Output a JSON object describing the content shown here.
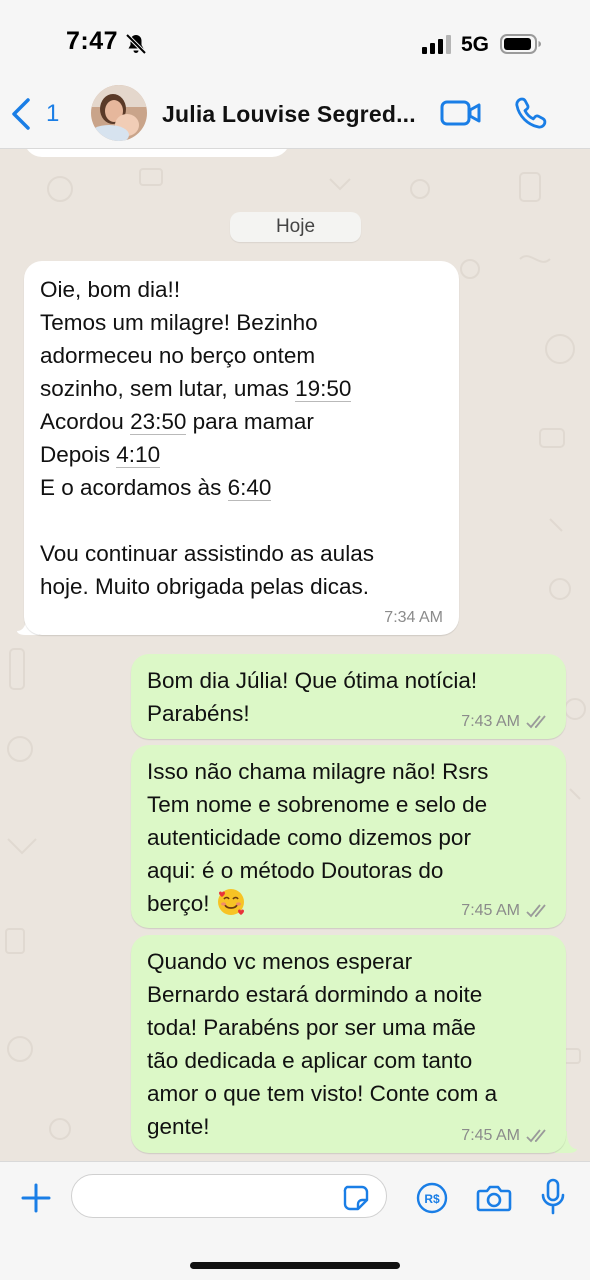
{
  "status_bar": {
    "time": "7:47",
    "network": "5G"
  },
  "header": {
    "back_count": "1",
    "contact_name": "Julia Louvise Segred..."
  },
  "chat": {
    "date_label": "Hoje",
    "messages": [
      {
        "direction": "incoming",
        "text_runs": [
          "Oie, bom dia!!\nTemos um milagre! Bezinho\nadormeceu no berço ontem\nsozinho, sem lutar, umas ",
          "19:50",
          "\nAcordou ",
          "23:50",
          " para mamar\nDepois ",
          "4:10",
          "\nE o acordamos às ",
          "6:40",
          "\n\nVou continuar assistindo as aulas\nhoje. Muito obrigada pelas dicas."
        ],
        "time": "7:34 AM"
      },
      {
        "direction": "outgoing",
        "text": "Bom dia Júlia! Que ótima notícia!\nParabéns!",
        "time": "7:43 AM",
        "status": "read"
      },
      {
        "direction": "outgoing",
        "text": "Isso não chama milagre não! Rsrs\nTem nome e sobrenome e selo de\nautenticidade como dizemos por\naqui: é o método Doutoras do\nberço! ",
        "emoji": "smiling-face-with-hearts",
        "time": "7:45 AM",
        "status": "read"
      },
      {
        "direction": "outgoing",
        "text": "Quando vc menos esperar\nBernardo estará dormindo a noite\ntoda! Parabéns por ser uma mãe\ntão dedicada e aplicar com tanto\namor o que tem visto! Conte com a\ngente!",
        "time": "7:45 AM",
        "status": "read"
      }
    ]
  },
  "input_bar": {
    "placeholder": ""
  },
  "colors": {
    "accent": "#1a7ee6",
    "outgoing_bubble": "#dcf8c7",
    "incoming_bubble": "#ffffff",
    "wallpaper": "#ebe5de"
  }
}
